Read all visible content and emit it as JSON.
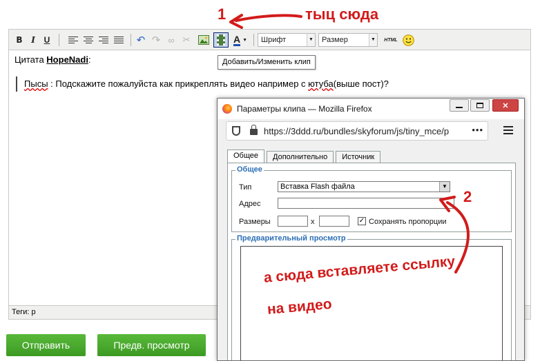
{
  "annotations": {
    "step1_number": "1",
    "step1_text": "тыц сюда",
    "step2_number": "2",
    "step2_text_line1": "а сюда вставляете ссылку",
    "step2_text_line2": "на видео",
    "color": "#d21b1b"
  },
  "toolbar": {
    "bold": "B",
    "italic": "I",
    "underline": "U",
    "font_select": "Шрифт",
    "size_select": "Размер",
    "html_button": "HTML",
    "tooltip": "Добавить/Изменить клип"
  },
  "editor": {
    "quote_prefix": "Цитата",
    "quote_author": "HopeNadi",
    "quote_suffix": ":",
    "quote_word_misspelled": "Пысы",
    "quote_text_1": " : Подскажите пожалуйста как прикреплять видео например с ",
    "quote_word_misspelled_2": "ютуба",
    "quote_text_2": "(выше пост)?",
    "tags": "Теги: p"
  },
  "buttons": {
    "submit": "Отправить",
    "preview": "Предв. просмотр",
    "color": "#4aaa2d"
  },
  "popup": {
    "title": "Параметры клипа — Mozilla Firefox",
    "url": "https://3ddd.ru/bundles/skyforum/js/tiny_mce/p",
    "url_more": "•••",
    "tabs": [
      {
        "label": "Общее"
      },
      {
        "label": "Дополнительно"
      },
      {
        "label": "Источник"
      }
    ],
    "general": {
      "legend": "Общее",
      "type_label": "Тип",
      "type_value": "Вставка Flash файла",
      "address_label": "Адрес",
      "address_value": "",
      "sizes_label": "Размеры",
      "sizes_sep": "x",
      "keep_ratio_label": "Сохранять пропорции",
      "keep_ratio_checked": "✓"
    },
    "preview_legend": "Предварительный просмотр"
  }
}
